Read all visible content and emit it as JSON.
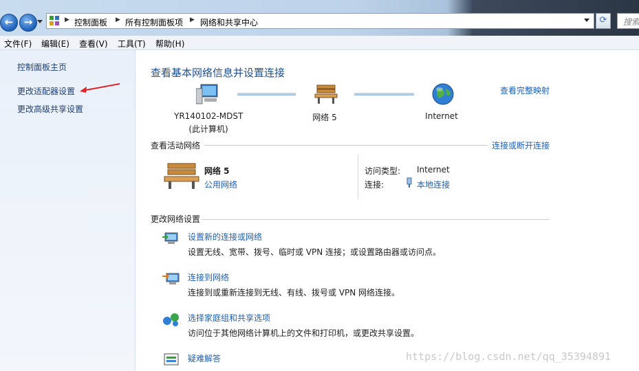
{
  "address_bar": {
    "breadcrumbs": [
      "控制面板",
      "所有控制面板项",
      "网络和共享中心"
    ],
    "search_placeholder": "搜索"
  },
  "menu": [
    "文件(F)",
    "编辑(E)",
    "查看(V)",
    "工具(T)",
    "帮助(H)"
  ],
  "sidebar": {
    "items": [
      "控制面板主页",
      "更改适配器设置",
      "更改高级共享设置"
    ]
  },
  "main": {
    "title": "查看基本网络信息并设置连接",
    "view_full_map": "查看完整映射",
    "map": {
      "computer_name": "YR140102-MDST",
      "computer_sub": "(此计算机)",
      "network_name": "网络  5",
      "internet": "Internet"
    },
    "active_networks": {
      "heading": "查看活动网络",
      "connect_link": "连接或断开连接",
      "network_name": "网络  5",
      "network_type": "公用网络",
      "access_type_label": "访问类型:",
      "access_type_value": "Internet",
      "connections_label": "连接:",
      "connections_value": "本地连接"
    },
    "change_settings": {
      "heading": "更改网络设置",
      "tasks": [
        {
          "title": "设置新的连接或网络",
          "desc": "设置无线、宽带、拨号、临时或 VPN 连接；或设置路由器或访问点。"
        },
        {
          "title": "连接到网络",
          "desc": "连接到或重新连接到无线、有线、拨号或 VPN 网络连接。"
        },
        {
          "title": "选择家庭组和共享选项",
          "desc": "访问位于其他网络计算机上的文件和打印机，或更改共享设置。"
        },
        {
          "title": "疑难解答",
          "desc": ""
        }
      ]
    }
  },
  "watermark": "https://blog.csdn.net/qq_35394891"
}
